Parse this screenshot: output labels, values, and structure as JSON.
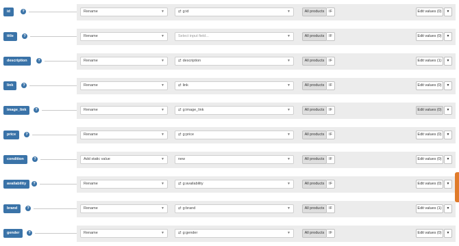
{
  "all_products_label": "All products",
  "if_label": "IF",
  "rows": [
    {
      "attribute": "id",
      "mode": "Rename",
      "source": "g:id",
      "source_icon": "shuffle-icon",
      "source_placeholder": false,
      "edit_values": "Edit values (0)",
      "edit_active": false
    },
    {
      "attribute": "title",
      "mode": "Rename",
      "source": "Select input field...",
      "source_icon": "",
      "source_placeholder": true,
      "edit_values": "Edit values (0)",
      "edit_active": false
    },
    {
      "attribute": "description",
      "mode": "Rename",
      "source": "description",
      "source_icon": "shuffle-icon",
      "source_placeholder": false,
      "edit_values": "Edit values (1)",
      "edit_active": false
    },
    {
      "attribute": "link",
      "mode": "Rename",
      "source": "link",
      "source_icon": "shuffle-icon",
      "source_placeholder": false,
      "edit_values": "Edit values (0)",
      "edit_active": false
    },
    {
      "attribute": "image_link",
      "mode": "Rename",
      "source": "g:image_link",
      "source_icon": "shuffle-icon",
      "source_placeholder": false,
      "edit_values": "Edit values (0)",
      "edit_active": true
    },
    {
      "attribute": "price",
      "mode": "Rename",
      "source": "g:price",
      "source_icon": "shuffle-icon",
      "source_placeholder": false,
      "edit_values": "Edit values (0)",
      "edit_active": false
    },
    {
      "attribute": "condition",
      "mode": "Add static value",
      "source": "new",
      "source_icon": "",
      "source_placeholder": false,
      "edit_values": "Edit values (0)",
      "edit_active": false
    },
    {
      "attribute": "availability",
      "mode": "Rename",
      "source": "g:availability",
      "source_icon": "shuffle-icon",
      "source_placeholder": false,
      "edit_values": "Edit values (0)",
      "edit_active": false
    },
    {
      "attribute": "brand",
      "mode": "Rename",
      "source": "g:brand",
      "source_icon": "shuffle-icon",
      "source_placeholder": false,
      "edit_values": "Edit values (1)",
      "edit_active": false
    },
    {
      "attribute": "gender",
      "mode": "Rename",
      "source": "g:gender",
      "source_icon": "shuffle-icon",
      "source_placeholder": false,
      "edit_values": "Edit values (0)",
      "edit_active": false
    }
  ]
}
